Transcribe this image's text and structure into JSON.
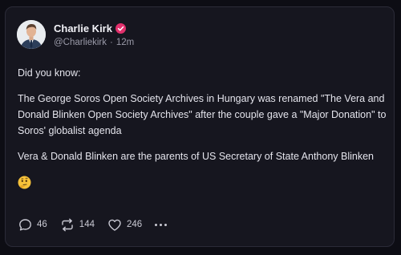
{
  "post": {
    "author": {
      "name": "Charlie Kirk",
      "handle": "@Charliekirk",
      "time": "12m",
      "separator": "·"
    },
    "body": {
      "p1": "Did you know:",
      "p2": "The George Soros Open Society Archives in Hungary was renamed \"The Vera and Donald Blinken Open Society Archives\" after the couple gave a \"Major Donation\" to Soros' globalist agenda",
      "p3": "Vera & Donald Blinken are the parents of US Secretary of State Anthony Blinken"
    },
    "stats": {
      "replies": "46",
      "reposts": "144",
      "likes": "246"
    }
  },
  "icons": {
    "verified": "verified-badge-icon",
    "reply": "speech-bubble-icon",
    "repost": "repost-arrows-icon",
    "like": "heart-icon",
    "more": "more-dots-icon",
    "emoji": "thinking-face-emoji"
  },
  "colors": {
    "background": "#0d0d14",
    "card": "#16161f",
    "verified": "#e1306c",
    "text": "#e4e4ec",
    "muted": "#9a9aa8"
  }
}
